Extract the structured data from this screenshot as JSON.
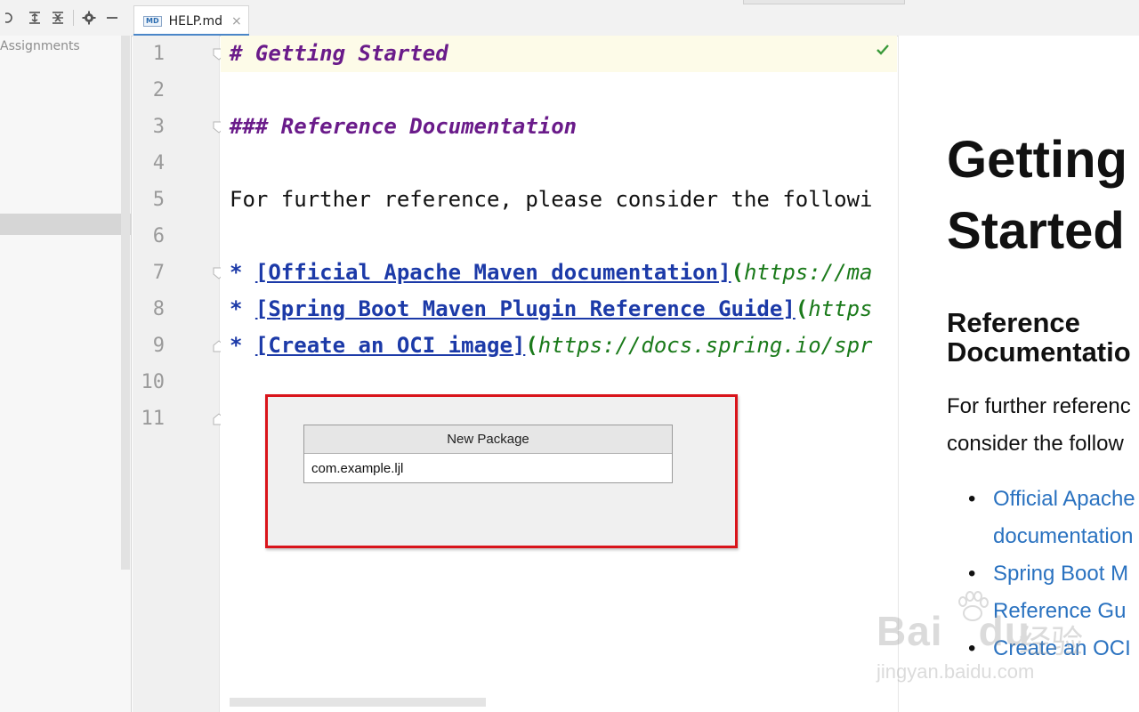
{
  "toolbar": {
    "icons": [
      "target-icon",
      "expand-all-icon",
      "collapse-all-icon",
      "gear-icon",
      "minimize-icon"
    ]
  },
  "tab": {
    "badge": "MD",
    "label": "HELP.md",
    "close": "×"
  },
  "project_panel": {
    "item": "Assignments"
  },
  "editor": {
    "line_numbers": [
      "1",
      "2",
      "3",
      "4",
      "5",
      "6",
      "7",
      "8",
      "9",
      "10",
      "11"
    ],
    "line1": "# Getting Started",
    "line3": "### Reference Documentation",
    "line5": "For further reference, please consider the followi",
    "bullet": "*",
    "line7_link": "[Official Apache Maven documentation]",
    "line7_paren": "(",
    "line7_url": "https://ma",
    "line8_link": "[Spring Boot Maven Plugin Reference Guide]",
    "line8_paren": "(",
    "line8_url": "https",
    "line9_link": "[Create an OCI image]",
    "line9_paren": "(",
    "line9_url": "https://docs.spring.io/spr"
  },
  "dialog": {
    "title": "New Package",
    "input_value": "com.example.ljl"
  },
  "preview": {
    "h1_line1": "Getting",
    "h1_line2": "Started",
    "h3_line1": "Reference",
    "h3_line2": "Documentatio",
    "p_line1": "For further referenc",
    "p_line2": "consider the follow",
    "list": [
      [
        "Official Apache",
        "documentation"
      ],
      [
        "Spring Boot M",
        "Reference Gu"
      ],
      [
        "Create an OCI"
      ]
    ]
  },
  "watermark": {
    "logo": "Bai",
    "logo2": "du",
    "cn": "经验",
    "url": "jingyan.baidu.com"
  },
  "colors": {
    "heading": "#6a1b8a",
    "link": "#1c3aa8",
    "url": "#1a7a1a",
    "highlight_box": "#d9141b",
    "preview_link": "#2a72c0"
  }
}
